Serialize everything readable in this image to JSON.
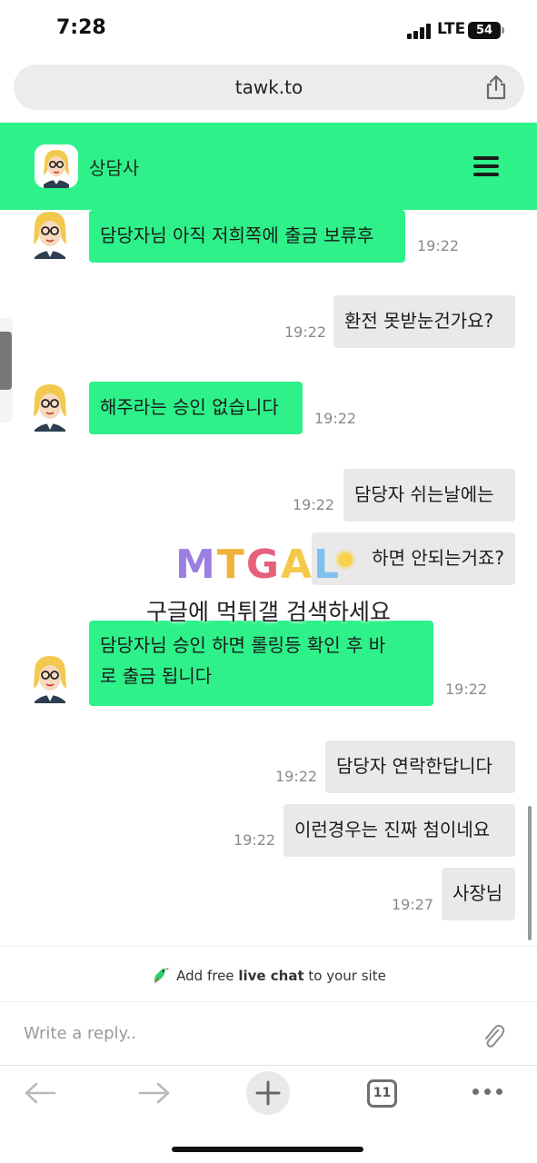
{
  "status_bar": {
    "time": "7:28",
    "network": "LTE",
    "battery": "54"
  },
  "browser": {
    "url": "tawk.to",
    "tab_count": "11"
  },
  "chat": {
    "header_title": "상담사",
    "colors": {
      "agent_bubble": "#2ef18a",
      "visitor_bubble": "#e9e9e9",
      "header": "#2ef18a"
    },
    "messages": [
      {
        "from": "agent",
        "lines": [
          "담당자님 아직 저희쪽에 출금 보류후"
        ],
        "time": "19:22"
      },
      {
        "from": "visitor",
        "lines": [
          "환전 못받눈건가요?"
        ],
        "time": "19:22"
      },
      {
        "from": "agent",
        "lines": [
          "해주라는 승인 없습니다"
        ],
        "time": "19:22"
      },
      {
        "from": "visitor",
        "lines": [
          "담당자 쉬는날에는"
        ],
        "time": "19:22"
      },
      {
        "from": "visitor",
        "lines": [
          "하면 안되는거죠?"
        ],
        "time": ""
      },
      {
        "from": "agent",
        "lines": [
          "담당자님 승인 하면 롤링등 확인 후 바",
          "로 출금 됩니다"
        ],
        "time": "19:22"
      },
      {
        "from": "visitor",
        "lines": [
          "담당자 연락한답니다"
        ],
        "time": "19:22"
      },
      {
        "from": "visitor",
        "lines": [
          "이런경우는 진짜 첨이네요"
        ],
        "time": "19:22"
      },
      {
        "from": "visitor",
        "lines": [
          "사장님"
        ],
        "time": "19:27"
      }
    ]
  },
  "watermark": {
    "logo_text": "MTGAL",
    "caption": "구글에 먹튀갤 검색하세요"
  },
  "footer": {
    "branding_prefix": "Add free ",
    "branding_strong": "live chat",
    "branding_suffix": " to your site",
    "reply_placeholder": "Write a reply.."
  }
}
